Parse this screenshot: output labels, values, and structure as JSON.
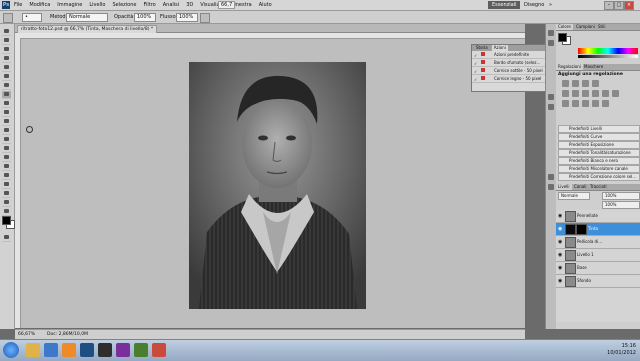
{
  "menubar": {
    "logo": "Ps",
    "items": [
      "File",
      "Modifica",
      "Immagine",
      "Livello",
      "Selezione",
      "Filtro",
      "Analisi",
      "3D",
      "Visualizza",
      "Finestra",
      "Aiuto"
    ],
    "zoom": "66,7",
    "workspace_active": "Essenziali",
    "workspace_other": "Disegno",
    "workspace_more": "»",
    "window_buttons": [
      "–",
      "□",
      "×"
    ]
  },
  "options": {
    "mode_label": "Metodo:",
    "mode_value": "Normale",
    "opacity_label": "Opacità:",
    "opacity_value": "100%",
    "flow_label": "Flusso:",
    "flow_value": "100%"
  },
  "document": {
    "tab_title": "ritratto-foto12.psd @ 66,7% (Tinta, Maschera di livello/8) *",
    "status_zoom": "66,67%",
    "status_info": "Doc: 2,86M/10,0M"
  },
  "history_panel": {
    "tabs": [
      "Storia",
      "Azioni"
    ],
    "active_tab": "Azioni",
    "rows": [
      {
        "check": "✓",
        "text": "Azioni predefinite"
      },
      {
        "check": "✓",
        "text": "Bordo sfumato (selez..."
      },
      {
        "check": "✓",
        "text": "Cornice sottile - 50 pixel"
      },
      {
        "check": "✓",
        "text": "Cornice legno - 50 pixel"
      }
    ]
  },
  "right_panel": {
    "swatch_tabs": [
      "Colore",
      "Campioni",
      "Stili"
    ],
    "adjust_tabs": [
      "Regolazioni",
      "Maschere"
    ],
    "adjust_title": "Aggiungi una regolazione",
    "presets": [
      "Predefiniti Livelli",
      "Predefiniti Curve",
      "Predefiniti Esposizione",
      "Predefiniti Tonalità/saturazione",
      "Predefiniti Bianco e nero",
      "Predefiniti Miscelatore canale",
      "Predefiniti Correzione colore sel..."
    ],
    "layer_tabs": [
      "Livelli",
      "Canali",
      "Tracciati"
    ],
    "blend_mode": "Normale",
    "opacity_label": "Opacità:",
    "opacity_value": "100%",
    "fill_label": "Riemp.:",
    "fill_value": "100%",
    "layers": [
      {
        "name": "Pennellate",
        "selected": false,
        "mask": false
      },
      {
        "name": "Tinta",
        "selected": true,
        "mask": true
      },
      {
        "name": "Pellicola di…",
        "selected": false,
        "mask": false
      },
      {
        "name": "Livello 1",
        "selected": false,
        "mask": false
      },
      {
        "name": "Base",
        "selected": false,
        "mask": false
      },
      {
        "name": "Sfondo",
        "selected": false,
        "mask": false
      }
    ]
  },
  "taskbar": {
    "time": "15:16",
    "date": "10/01/2012"
  },
  "colors": {
    "accent_selected": "#3c8fd8",
    "panel_bg": "#cfcfcf",
    "canvas_bg": "#bebebe"
  }
}
